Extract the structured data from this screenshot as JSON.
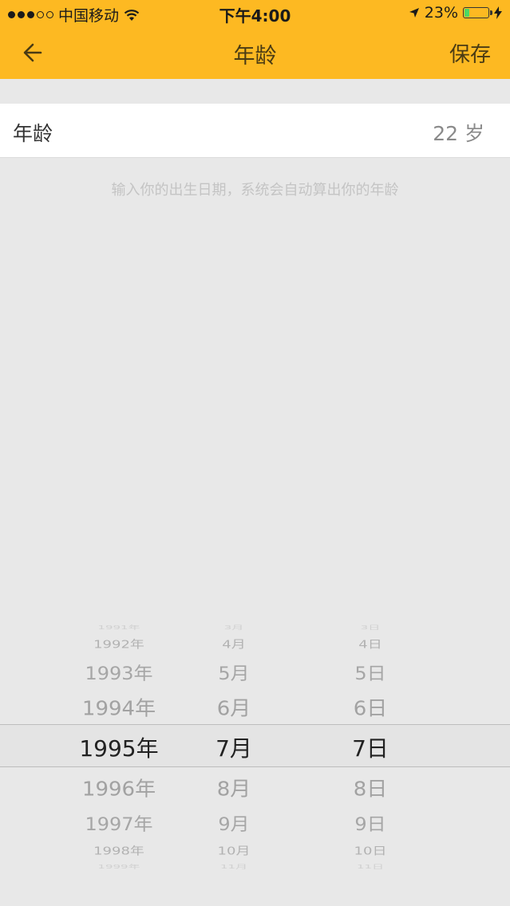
{
  "status_bar": {
    "carrier": "中国移动",
    "time": "下午4:00",
    "battery": "23%",
    "battery_level": 0.23,
    "signal_bars": 3,
    "signal_total": 5
  },
  "nav": {
    "title": "年龄",
    "save_label": "保存",
    "back_icon": "arrow-left-icon"
  },
  "age_row": {
    "label": "年龄",
    "value": "22 岁"
  },
  "hint": "输入你的出生日期，系统会自动算出你的年龄",
  "picker": {
    "years": [
      "1991年",
      "1992年",
      "1993年",
      "1994年",
      "1995年",
      "1996年",
      "1997年",
      "1998年",
      "1999年"
    ],
    "months": [
      "3月",
      "4月",
      "5月",
      "6月",
      "7月",
      "8月",
      "9月",
      "10月",
      "11月"
    ],
    "days": [
      "3日",
      "4日",
      "5日",
      "6日",
      "7日",
      "8日",
      "9日",
      "10日",
      "11日"
    ],
    "selected": {
      "year": "1995年",
      "month": "7月",
      "day": "7日"
    }
  },
  "colors": {
    "accent": "#fdb922",
    "background": "#e8e8e8",
    "selected_text": "#222222",
    "dim_text": "#a6a6a6"
  }
}
